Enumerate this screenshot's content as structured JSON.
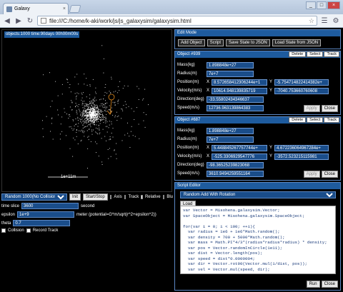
{
  "browser": {
    "tab_title": "Galaxy",
    "tab_close": "×",
    "url": "file:///C:/home/k-aki/work/js/js_galaxysim/galaxysim.html",
    "controls": [
      "_",
      "□",
      "×"
    ]
  },
  "canvas": {
    "status": "objects:1000 time:90days 00h00m00s",
    "scale_label": "1e+11m"
  },
  "controls": {
    "preset": "Random 1000(No Collision)",
    "init_label": "Init",
    "startstop_label": "Start/Stop",
    "axis_label": "Axis",
    "track_label": "Track",
    "relative_label": "Relative",
    "blur_label": "Blu",
    "timeslice_label": "time slice",
    "timeslice_value": "3600",
    "timeslice_unit": "second",
    "epsilon_label": "epsilon",
    "epsilon_value": "1e+9",
    "epsilon_unit": "meter (potential=G*m/sqrt(r^2+epsilon^2))",
    "theta_label": "theta",
    "theta_value": "0.7",
    "collision_label": "Collision",
    "recordtrack_label": "Record Track"
  },
  "edit_mode": {
    "title": "Edit Mode",
    "buttons": [
      "Add Object",
      "Script",
      "Save State to JSON",
      "Load State from JSON"
    ]
  },
  "objects": [
    {
      "title": "Object #939",
      "head_buttons": [
        "Delete",
        "Select",
        "Track"
      ],
      "mass_label": "Mass(kg)",
      "mass": "1.898848e+27",
      "radius_label": "Radius(m)",
      "radius": "7e+7",
      "position_label": "Position(m)",
      "pos_x": "8.572658412306244e+1",
      "pos_y": "-5.754714822414382e+",
      "velocity_label": "Velocity(m/s)",
      "vel_x": "10614.948139835719",
      "vel_y": "-7040.753660760608",
      "direction_label": "Direction(deg)",
      "direction": "-33.55802434346637",
      "speed_label": "Speed(m/s)",
      "speed": "12736.963139864383",
      "apply": "Apply",
      "close": "Close"
    },
    {
      "title": "Object #687",
      "head_buttons": [
        "Delete",
        "Select",
        "Track"
      ],
      "mass_label": "Mass(kg)",
      "mass": "1.898848e+27",
      "radius_label": "Radius(m)",
      "radius": "7e+7",
      "position_label": "Position(m)",
      "pos_x": "5.448845267757744e+",
      "pos_y": "4.672236064967284e+",
      "velocity_label": "Velocity(m/s)",
      "vel_x": "-525.3306929547776",
      "vel_y": "-3572.523215115981",
      "direction_label": "Direction(deg)",
      "direction": "-98.36525239823068",
      "speed_label": "Speed(m/s)",
      "speed": "3610.9494259551164",
      "apply": "Apply",
      "close": "Close"
    }
  ],
  "script_editor": {
    "title": "Script Editor",
    "preset": "Random Add With Rotation",
    "load_label": "Load",
    "code": "var Vector = Misohena.galaxysim.Vector;\nvar SpaceObject = Misohena.galaxysim.SpaceObject;\n\nfor(var i = 0; i < 100; ++i){\n  var radius = 1e6 + 1e6*Math.random();\n  var density = 700 + 5000*Math.random();\n  var mass = Math.PI*4/3*(radius*radius*radius) * density;\n  var pos = Vector.randomInCircle(1e11);\n  var dist = Vector.length(pos);\n  var speed = dist*0.0000004;\n  var dir = Vector.rot90(Vector.mul(1/dist, pos));\n  var vel = Vector.mul(speed, dir);\n\n  space.addObject(new SpaceObject(mass, radius, pos, vel));\n}",
    "run_label": "Run",
    "close_label": "Close"
  },
  "colors": {
    "accent": "#1e5b9e",
    "field": "#1a4d8a",
    "marker": "#e08a1e"
  }
}
